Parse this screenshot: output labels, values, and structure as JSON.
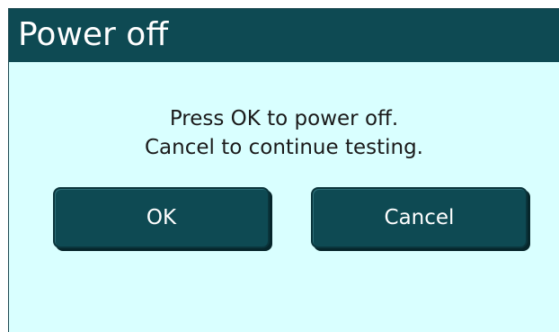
{
  "dialog": {
    "title": "Power off",
    "message_line1": "Press OK to power off.",
    "message_line2": "Cancel to continue testing.",
    "ok_label": "OK",
    "cancel_label": "Cancel"
  },
  "colors": {
    "titlebar": "#0e4a53",
    "body": "#d9ffff",
    "button": "#0e4a53",
    "button_text": "#ffffff"
  }
}
